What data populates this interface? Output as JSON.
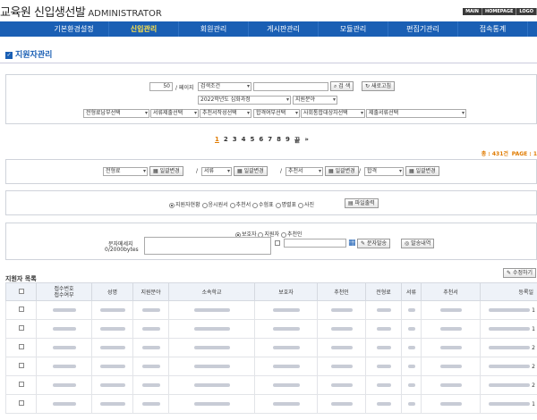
{
  "header": {
    "brand_main": "교육원 신입생선발",
    "brand_sub": "ADMINISTRATOR",
    "top_links": [
      "MAIN",
      "HOMEPAGE",
      "LOGO"
    ]
  },
  "nav": {
    "items": [
      "기본환경설정",
      "신입관리",
      "회원관리",
      "게시판관리",
      "모듈관리",
      "편집기관리",
      "접속통계"
    ],
    "active_index": 1
  },
  "page_title": "지원자관리",
  "search": {
    "per_page_value": "50",
    "per_page_label": "/ 페이지",
    "condition_select": "검색조건",
    "keyword_placeholder": "",
    "search_button": "검 색",
    "reset_button": "새로고침",
    "course_select": "2022학년도 심화과정",
    "field_select": "지원분야",
    "filters": [
      "전형료납부선택",
      "서류제출선택",
      "추천서작성선택",
      "합격여부선택",
      "사회통합대상자선택",
      "제출서류선택"
    ]
  },
  "pager": {
    "pages": [
      "1",
      "2",
      "3",
      "4",
      "5",
      "6",
      "7",
      "8",
      "9",
      "끝"
    ],
    "current": "1",
    "next": "»"
  },
  "counts": {
    "total_label": "총 : 431건",
    "page_label": "PAGE : 1"
  },
  "batch": {
    "groups": [
      {
        "select": "전형료",
        "button": "일괄변경"
      },
      {
        "select": "서류",
        "button": "일괄변경"
      },
      {
        "select": "추천서",
        "button": "일괄변경"
      },
      {
        "select": "합격",
        "button": "일괄변경"
      }
    ],
    "separator": "/"
  },
  "export": {
    "options": [
      "지원자현황",
      "응시원서",
      "추천서",
      "수험표",
      "명렬표",
      "사진"
    ],
    "selected": 0,
    "button": "파일출력"
  },
  "sms": {
    "targets": [
      "보호자",
      "지원자",
      "추천인"
    ],
    "selected": 0,
    "label": "문자메세지",
    "bytes": "0/2000bytes",
    "send_button": "문자발송",
    "history_button": "발송내역"
  },
  "list": {
    "title": "지원자 목록",
    "edit_button": "수정하기",
    "columns": [
      "",
      "접수번호\n접수여부",
      "성명",
      "지원분야",
      "소속학교",
      "보호자",
      "추천인",
      "전형료",
      "서류",
      "추천서",
      "등록일"
    ],
    "row_count": 6,
    "last_col_suffix": [
      "1",
      "1",
      "2",
      "2",
      "2",
      "1"
    ]
  },
  "colors": {
    "nav_bg": "#1a5fb4",
    "nav_active": "#ffe24a",
    "accent_orange": "#e07b00"
  }
}
